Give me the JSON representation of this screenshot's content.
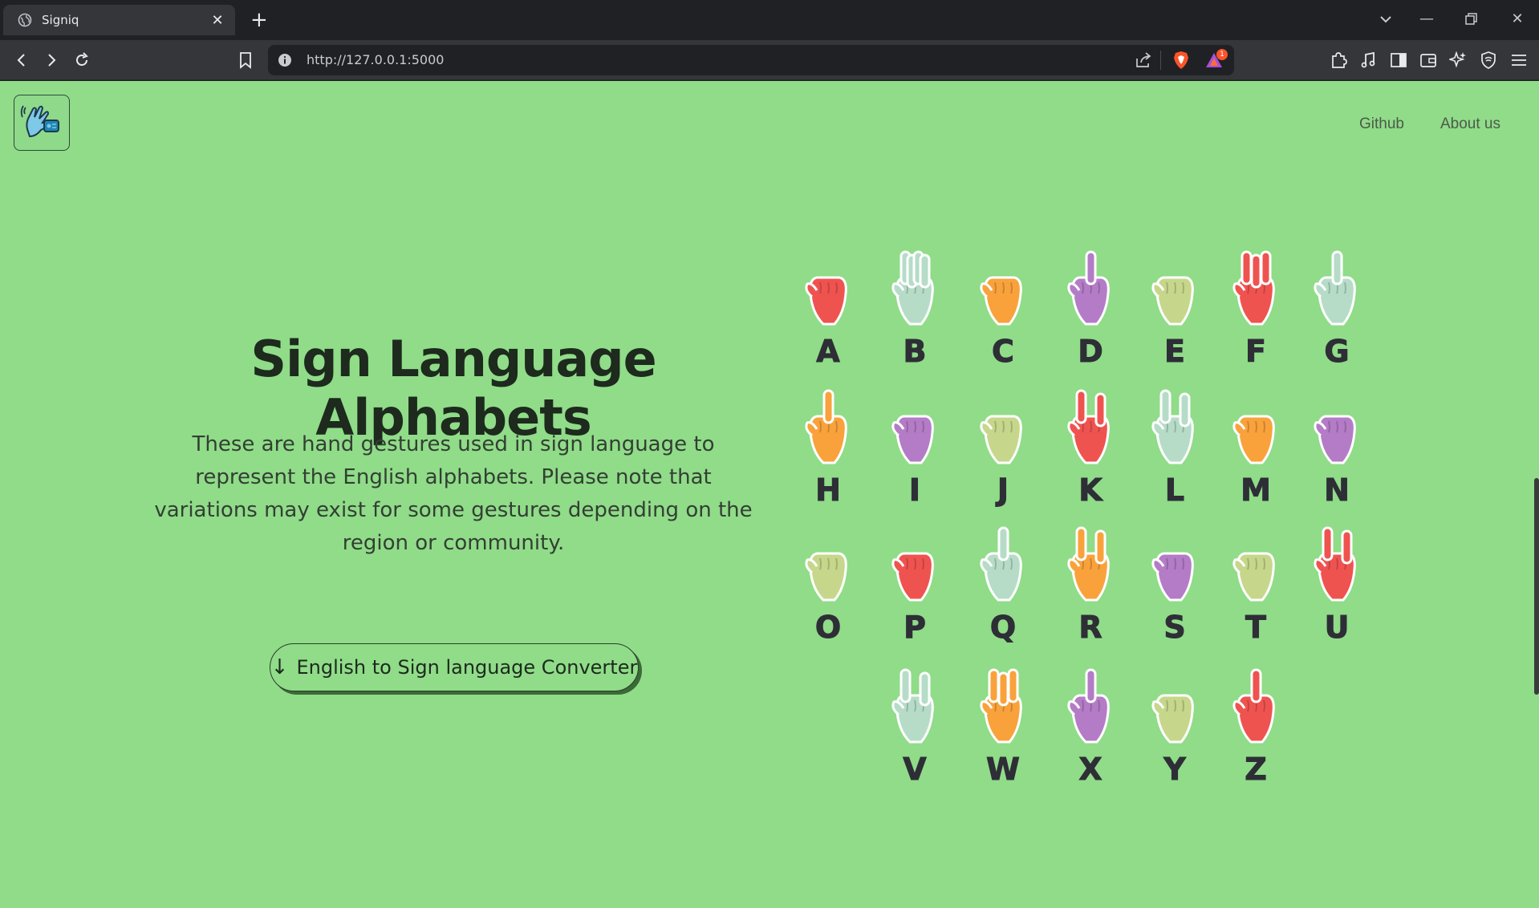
{
  "browser": {
    "tab_title": "Signiq",
    "url": "http://127.0.0.1:5000",
    "notification_count": "1"
  },
  "nav": {
    "links": [
      "Github",
      "About us"
    ]
  },
  "hero": {
    "title": "Sign Language Alphabets",
    "description": "These are hand gestures used in sign language to represent the English alphabets. Please note that variations may exist for some gestures depending on the region or community.",
    "cta_label": "English to Sign language Converter"
  },
  "colors": {
    "page_bg": "#90dc89",
    "red": "#ef5350",
    "mint": "#b6dcc8",
    "orange": "#f9a23c",
    "purple": "#b47cc7",
    "olive": "#c6d78b"
  },
  "signs": [
    {
      "letter": "A",
      "color": "red"
    },
    {
      "letter": "B",
      "color": "mint"
    },
    {
      "letter": "C",
      "color": "orange"
    },
    {
      "letter": "D",
      "color": "purple"
    },
    {
      "letter": "E",
      "color": "olive"
    },
    {
      "letter": "F",
      "color": "red"
    },
    {
      "letter": "G",
      "color": "mint"
    },
    {
      "letter": "H",
      "color": "orange"
    },
    {
      "letter": "I",
      "color": "purple"
    },
    {
      "letter": "J",
      "color": "olive"
    },
    {
      "letter": "K",
      "color": "red"
    },
    {
      "letter": "L",
      "color": "mint"
    },
    {
      "letter": "M",
      "color": "orange"
    },
    {
      "letter": "N",
      "color": "purple"
    },
    {
      "letter": "O",
      "color": "olive"
    },
    {
      "letter": "P",
      "color": "red"
    },
    {
      "letter": "Q",
      "color": "mint"
    },
    {
      "letter": "R",
      "color": "orange"
    },
    {
      "letter": "S",
      "color": "purple"
    },
    {
      "letter": "T",
      "color": "olive"
    },
    {
      "letter": "U",
      "color": "red"
    },
    {
      "letter": "V",
      "color": "mint"
    },
    {
      "letter": "W",
      "color": "orange"
    },
    {
      "letter": "X",
      "color": "purple"
    },
    {
      "letter": "Y",
      "color": "olive"
    },
    {
      "letter": "Z",
      "color": "red"
    }
  ]
}
